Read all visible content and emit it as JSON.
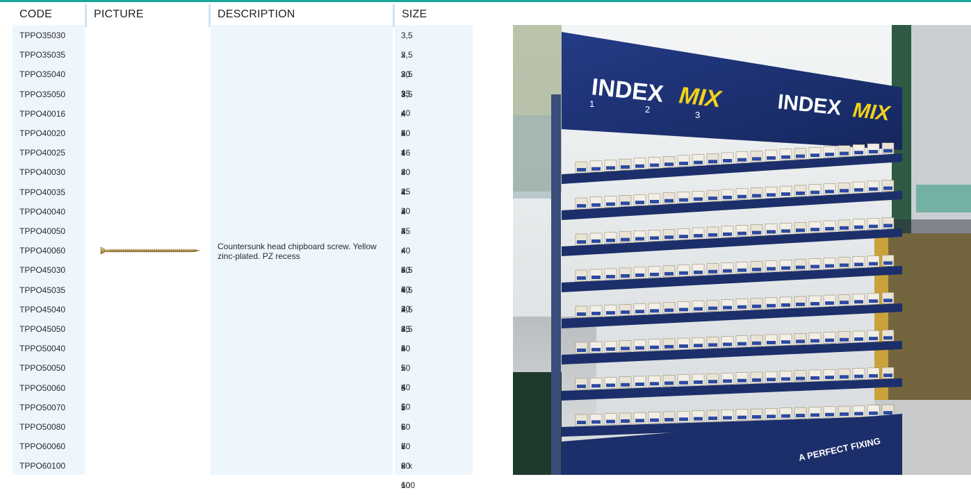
{
  "table": {
    "headers": {
      "code": "CODE",
      "picture": "PICTURE",
      "description": "DESCRIPTION",
      "size": "SIZE"
    },
    "description": "Countersunk head chipboard screw. Yellow zinc-plated. PZ recess",
    "rows": [
      {
        "code": "TPPO35030",
        "size": "3,5 x 30"
      },
      {
        "code": "TPPO35035",
        "size": "3,5 x 35"
      },
      {
        "code": "TPPO35040",
        "size": "3,5 x 40"
      },
      {
        "code": "TPPO35050",
        "size": "3,5 x 50"
      },
      {
        "code": "TPPO40016",
        "size": "4 x 16"
      },
      {
        "code": "TPPO40020",
        "size": "4 x 20"
      },
      {
        "code": "TPPO40025",
        "size": "4 x 25"
      },
      {
        "code": "TPPO40030",
        "size": "4 x 30"
      },
      {
        "code": "TPPO40035",
        "size": "4 x 35"
      },
      {
        "code": "TPPO40040",
        "size": "4 x 40"
      },
      {
        "code": "TPPO40050",
        "size": "4 x 50"
      },
      {
        "code": "TPPO40060",
        "size": "4 x 60"
      },
      {
        "code": "TPPO45030",
        "size": "4,5 x 30"
      },
      {
        "code": "TPPO45035",
        "size": "4,5 x 35"
      },
      {
        "code": "TPPO45040",
        "size": "4,5 x 40"
      },
      {
        "code": "TPPO45050",
        "size": "4,5 x 50"
      },
      {
        "code": "TPPO50040",
        "size": "5 x 40"
      },
      {
        "code": "TPPO50050",
        "size": "5 x 50"
      },
      {
        "code": "TPPO50060",
        "size": "5 x 60"
      },
      {
        "code": "TPPO50070",
        "size": "5 x 70"
      },
      {
        "code": "TPPO50080",
        "size": "5 x 80"
      },
      {
        "code": "TPPO60060",
        "size": "6 x 60"
      },
      {
        "code": "TPPO60100",
        "size": "6 x 100"
      }
    ]
  },
  "photo": {
    "sign_brand_1": "INDEX",
    "sign_brand_2": "MIX",
    "sign_steps": [
      "1",
      "2",
      "3"
    ],
    "base_slogan": "A PERFECT FIXING"
  },
  "colors": {
    "accent": "#19a59a",
    "column_bg": "#eef6fd",
    "display_blue": "#1c2f6b",
    "mix_yellow": "#f2d21b"
  }
}
